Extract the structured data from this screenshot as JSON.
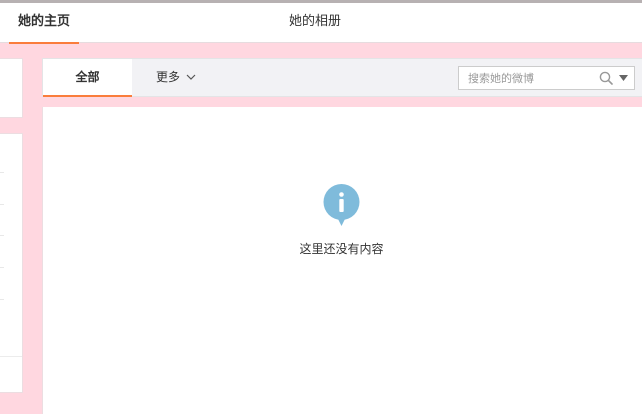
{
  "nav": {
    "tabs": [
      {
        "label": "她的主页",
        "active": true
      },
      {
        "label": "她的相册",
        "active": false
      }
    ]
  },
  "feed": {
    "tabs": {
      "all": "全部",
      "more": "更多"
    },
    "search": {
      "placeholder": "搜索她的微博"
    },
    "empty_message": "这里还没有内容"
  },
  "colors": {
    "background": "#ffd7e0",
    "accent": "#fa7d3c",
    "info_icon": "#7fbbdb"
  },
  "icons": {
    "search": "magnifier-icon",
    "dropdown": "caret-down-icon",
    "more": "chevron-down-icon",
    "empty": "info-bubble-icon"
  }
}
